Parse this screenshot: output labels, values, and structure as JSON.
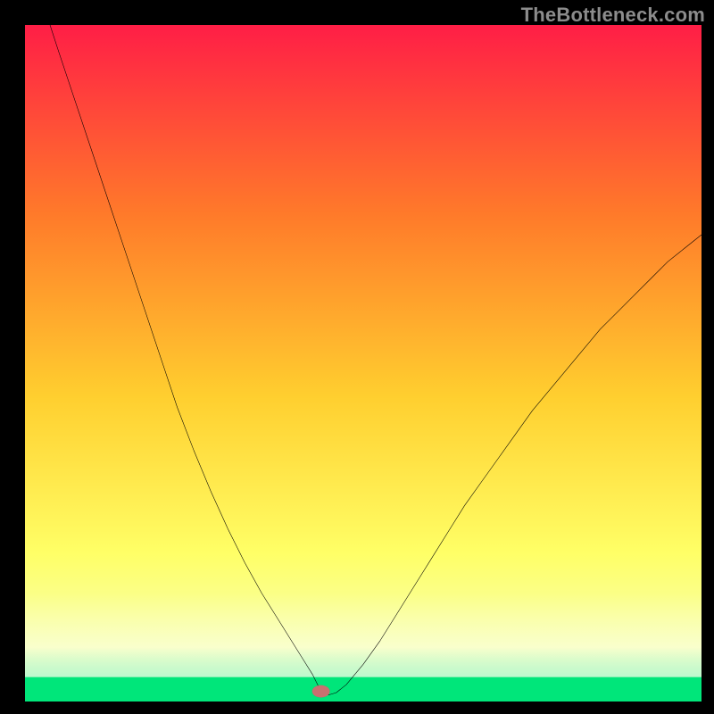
{
  "watermark": "TheBottleneck.com",
  "chart_data": {
    "type": "line",
    "title": "",
    "xlabel": "",
    "ylabel": "",
    "xlim": [
      0,
      100
    ],
    "ylim": [
      0,
      100
    ],
    "x": [
      3.7,
      5,
      7.5,
      10,
      12.5,
      15,
      17.5,
      20,
      22.5,
      25,
      27.5,
      30,
      32.5,
      35,
      37.5,
      40,
      41.25,
      42.5,
      43,
      43.5,
      43.75,
      44.5,
      45,
      46,
      47.5,
      50,
      52.5,
      55,
      57.5,
      60,
      62.5,
      65,
      67.5,
      70,
      72.5,
      75,
      77.5,
      80,
      82.5,
      85,
      87.5,
      90,
      92.5,
      95,
      97.5,
      100
    ],
    "y": [
      100,
      96,
      88.5,
      81,
      73.5,
      66,
      58.5,
      51,
      43.5,
      37,
      31,
      25.5,
      20.5,
      16,
      12,
      8,
      6,
      4,
      3,
      2,
      1.5,
      1,
      1,
      1.3,
      2.5,
      5.5,
      9,
      13,
      17,
      21,
      25,
      29,
      32.5,
      36,
      39.5,
      43,
      46,
      49,
      52,
      55,
      57.5,
      60,
      62.5,
      65,
      67,
      69
    ],
    "marker": {
      "x": 43.75,
      "y": 1.5
    },
    "green_band": {
      "y0": 0,
      "y1": 3.6
    },
    "fade_band": {
      "y0": 3.6,
      "y1": 16
    }
  },
  "colors": {
    "grad_top": "#ff1e46",
    "grad_mid_upper": "#ff7a2a",
    "grad_mid": "#ffcf2f",
    "grad_mid_lower": "#ffff66",
    "grad_lower": "#f6ffb0",
    "grad_bottom": "#00e67a",
    "curve": "#000000",
    "marker_fill": "#c97070",
    "marker_stroke": "#b25a5a",
    "frame": "#000000",
    "watermark": "#8c8c8c"
  }
}
